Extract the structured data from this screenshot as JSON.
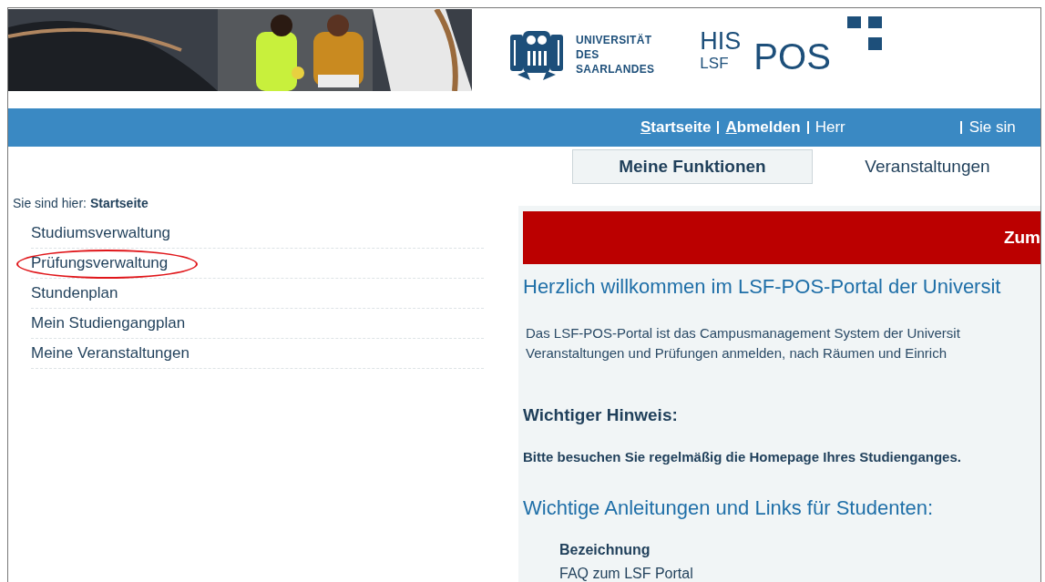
{
  "header": {
    "university_logo": {
      "lines": [
        "UNIVERSITÄT",
        "DES",
        "SAARLANDES"
      ]
    },
    "product_logo": {
      "top": "HIS",
      "bottom": "LSF",
      "main": "POS"
    }
  },
  "nav_bar": {
    "links": [
      {
        "accesskey_letter": "S",
        "rest": "tartseite"
      },
      {
        "accesskey_letter": "A",
        "rest": "bmelden"
      }
    ],
    "user": "Herr",
    "location_cut": "Sie sin"
  },
  "tabs": [
    {
      "label": "Meine Funktionen",
      "selected": true
    },
    {
      "label": "Veranstaltungen",
      "selected": false
    }
  ],
  "breadcrumb": {
    "prefix": "Sie sind hier:",
    "current": "Startseite"
  },
  "sidebar": {
    "items": [
      {
        "label": "Studiumsverwaltung",
        "highlighted": false
      },
      {
        "label": "Prüfungsverwaltung",
        "highlighted": true
      },
      {
        "label": "Stundenplan",
        "highlighted": false
      },
      {
        "label": "Mein Studiengangplan",
        "highlighted": false
      },
      {
        "label": "Meine Veranstaltungen",
        "highlighted": false
      }
    ]
  },
  "content": {
    "alert": "Zum",
    "title": "Herzlich willkommen im LSF-POS-Portal der Universit",
    "intro": [
      "Das LSF-POS-Portal ist das Campusmanagement System der Universit",
      "Veranstaltungen und Prüfungen anmelden, nach Räumen und Einrich"
    ],
    "notice_title": "Wichtiger Hinweis:",
    "notice_text": "Bitte besuchen Sie regelmäßig die Homepage Ihres Studienganges.",
    "links_title": "Wichtige Anleitungen und Links für Studenten:",
    "links_table": {
      "column": "Bezeichnung",
      "rows": [
        "FAQ zum LSF Portal"
      ]
    }
  }
}
